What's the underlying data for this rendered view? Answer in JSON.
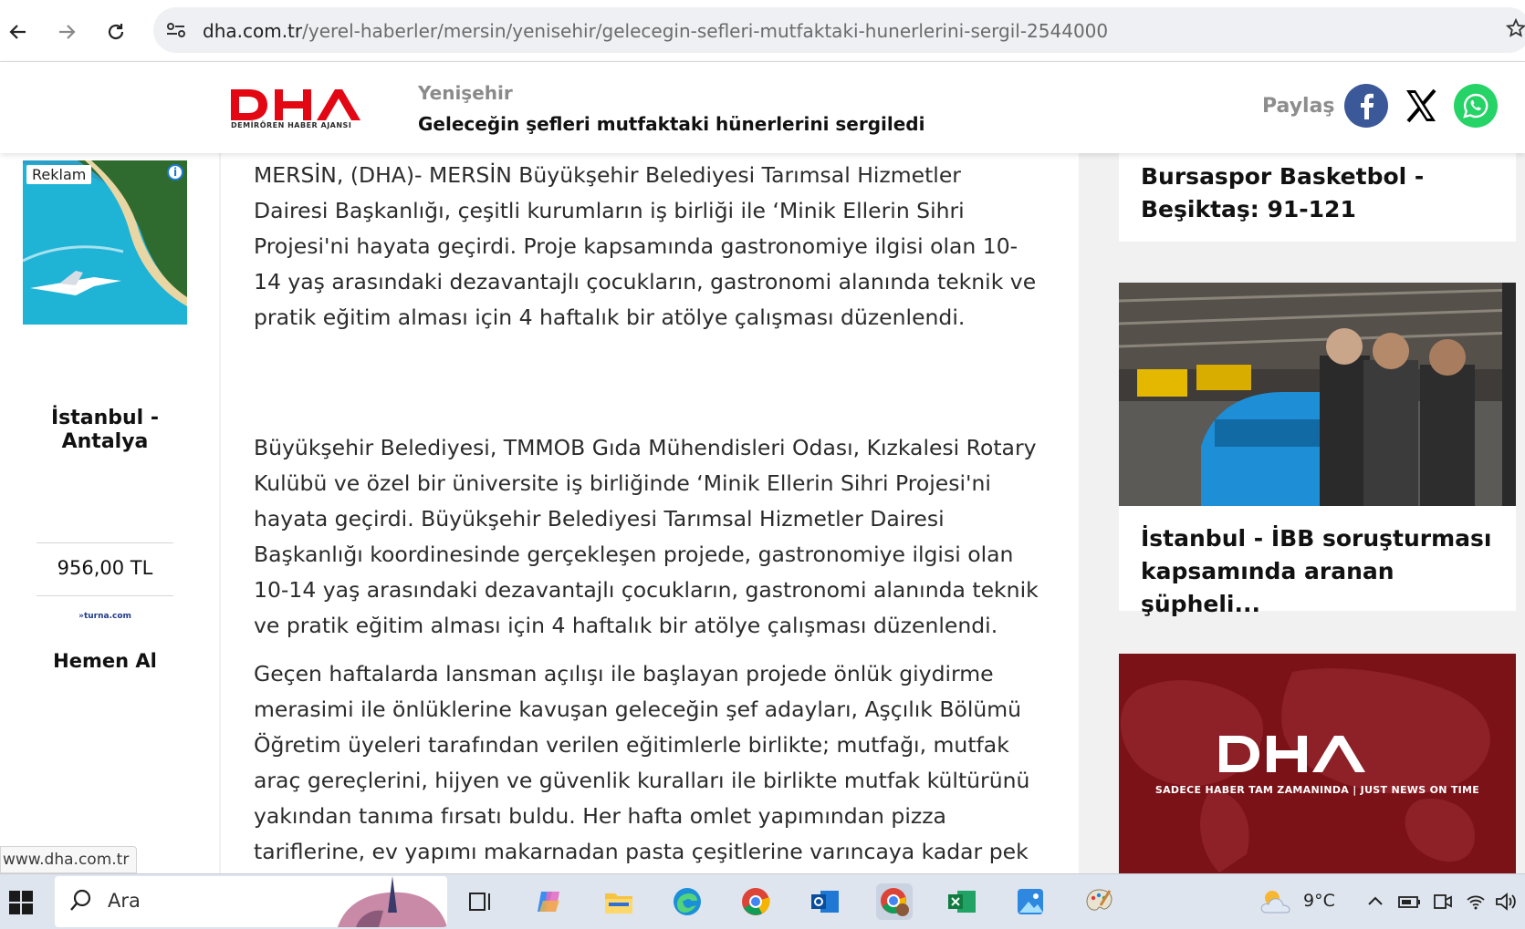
{
  "browser": {
    "url_domain": "dha.com.tr",
    "url_path": "/yerel-haberler/mersin/yenisehir/gelecegin-sefleri-mutfaktaki-hunerlerini-sergil-2544000"
  },
  "header": {
    "logo_text": "DHA",
    "logo_subtitle": "DEMİRÖREN HABER AJANSI",
    "breadcrumb": "Yenişehir",
    "title": "Geleceğin şefleri mutfaktaki hünerlerini sergiledi",
    "share_label": "Paylaş",
    "share_buttons": [
      {
        "icon": "facebook-icon",
        "color": "#3b5998"
      },
      {
        "icon": "x-icon",
        "color": "#000000"
      },
      {
        "icon": "whatsapp-icon",
        "color": "#25d366"
      }
    ]
  },
  "left_ad": {
    "badge": "Reklam",
    "info": "i",
    "route": "İstanbul - Antalya",
    "price": "956,00 TL",
    "brand": "»turna.com",
    "cta": "Hemen Al"
  },
  "article": {
    "paragraphs": [
      "MERSİN, (DHA)- MERSİN Büyükşehir Belediyesi Tarımsal Hizmetler Dairesi Başkanlığı, çeşitli kurumların iş birliği ile ‘Minik Ellerin Sihri Projesi'ni hayata geçirdi. Proje kapsamında gastronomiye ilgisi olan 10-14 yaş arasındaki dezavantajlı çocukların, gastronomi alanında teknik ve pratik eğitim alması için 4 haftalık bir atölye çalışması düzenlendi.",
      "Büyükşehir Belediyesi, TMMOB Gıda Mühendisleri Odası, Kızkalesi Rotary Kulübü ve özel bir üniversite iş birliğinde ‘Minik Ellerin Sihri Projesi'ni hayata geçirdi. Büyükşehir Belediyesi Tarımsal Hizmetler Dairesi Başkanlığı koordinesinde gerçekleşen projede, gastronomiye ilgisi olan 10-14 yaş arasındaki dezavantajlı çocukların, gastronomi alanında teknik ve pratik eğitim alması için 4 haftalık bir atölye çalışması düzenlendi.",
      "Geçen haftalarda lansman açılışı ile başlayan projede önlük giydirme merasimi ile önlüklerine kavuşan geleceğin şef adayları, Aşçılık Bölümü Öğretim üyeleri tarafından verilen eğitimlerle birlikte; mutfağı, mutfak araç gereçlerini, hijyen ve güvenlik kuralları ile birlikte mutfak kültürünü yakından tanıma fırsatı buldu. Her hafta omlet yapımından pizza tariflerine, ev yapımı makarnadan pasta çeşitlerine varıncaya kadar pek çok ürün deneyen ve"
    ]
  },
  "sidebar": {
    "news": [
      {
        "title": "Bursaspor Basketbol - Beşiktaş: 91-121"
      },
      {
        "title": "İstanbul - İBB soruşturması kapsamında aranan şüpheli..."
      }
    ],
    "promo": {
      "logo": "DHA",
      "tagline": "SADECE HABER TAM ZAMANINDA | JUST NEWS ON TIME"
    }
  },
  "status_bar": {
    "url": "www.dha.com.tr"
  },
  "taskbar": {
    "search_placeholder": "Ara",
    "weather": "9°C"
  }
}
